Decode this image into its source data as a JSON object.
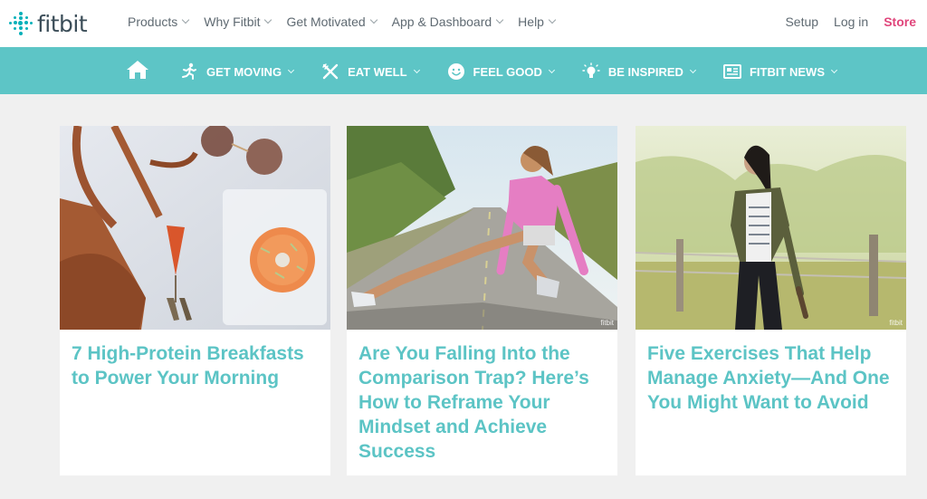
{
  "logo": {
    "text": "fitbit"
  },
  "topnav": {
    "items": [
      "Products",
      "Why Fitbit",
      "Get Motivated",
      "App & Dashboard",
      "Help"
    ],
    "setup": "Setup",
    "login": "Log in",
    "store": "Store"
  },
  "categories": [
    {
      "label": "GET MOVING",
      "icon": "running-person-icon"
    },
    {
      "label": "EAT WELL",
      "icon": "fork-knife-icon"
    },
    {
      "label": "FEEL GOOD",
      "icon": "smiley-icon"
    },
    {
      "label": "BE INSPIRED",
      "icon": "lightbulb-icon"
    },
    {
      "label": "FITBIT NEWS",
      "icon": "newspaper-icon"
    }
  ],
  "cards": [
    {
      "title": "7 High-Protein Breakfasts to Power Your Morning",
      "watermark": ""
    },
    {
      "title": "Are You Falling Into the Comparison Trap? Here’s How to Reframe Your Mindset and Achieve Success",
      "watermark": "fitbit"
    },
    {
      "title": "Five Exercises That Help Manage Anxiety—And One You Might Want to Avoid",
      "watermark": "fitbit"
    }
  ],
  "colors": {
    "teal": "#5dc5c6",
    "title_teal": "#5cc4c5",
    "store_pink": "#e0457b"
  }
}
